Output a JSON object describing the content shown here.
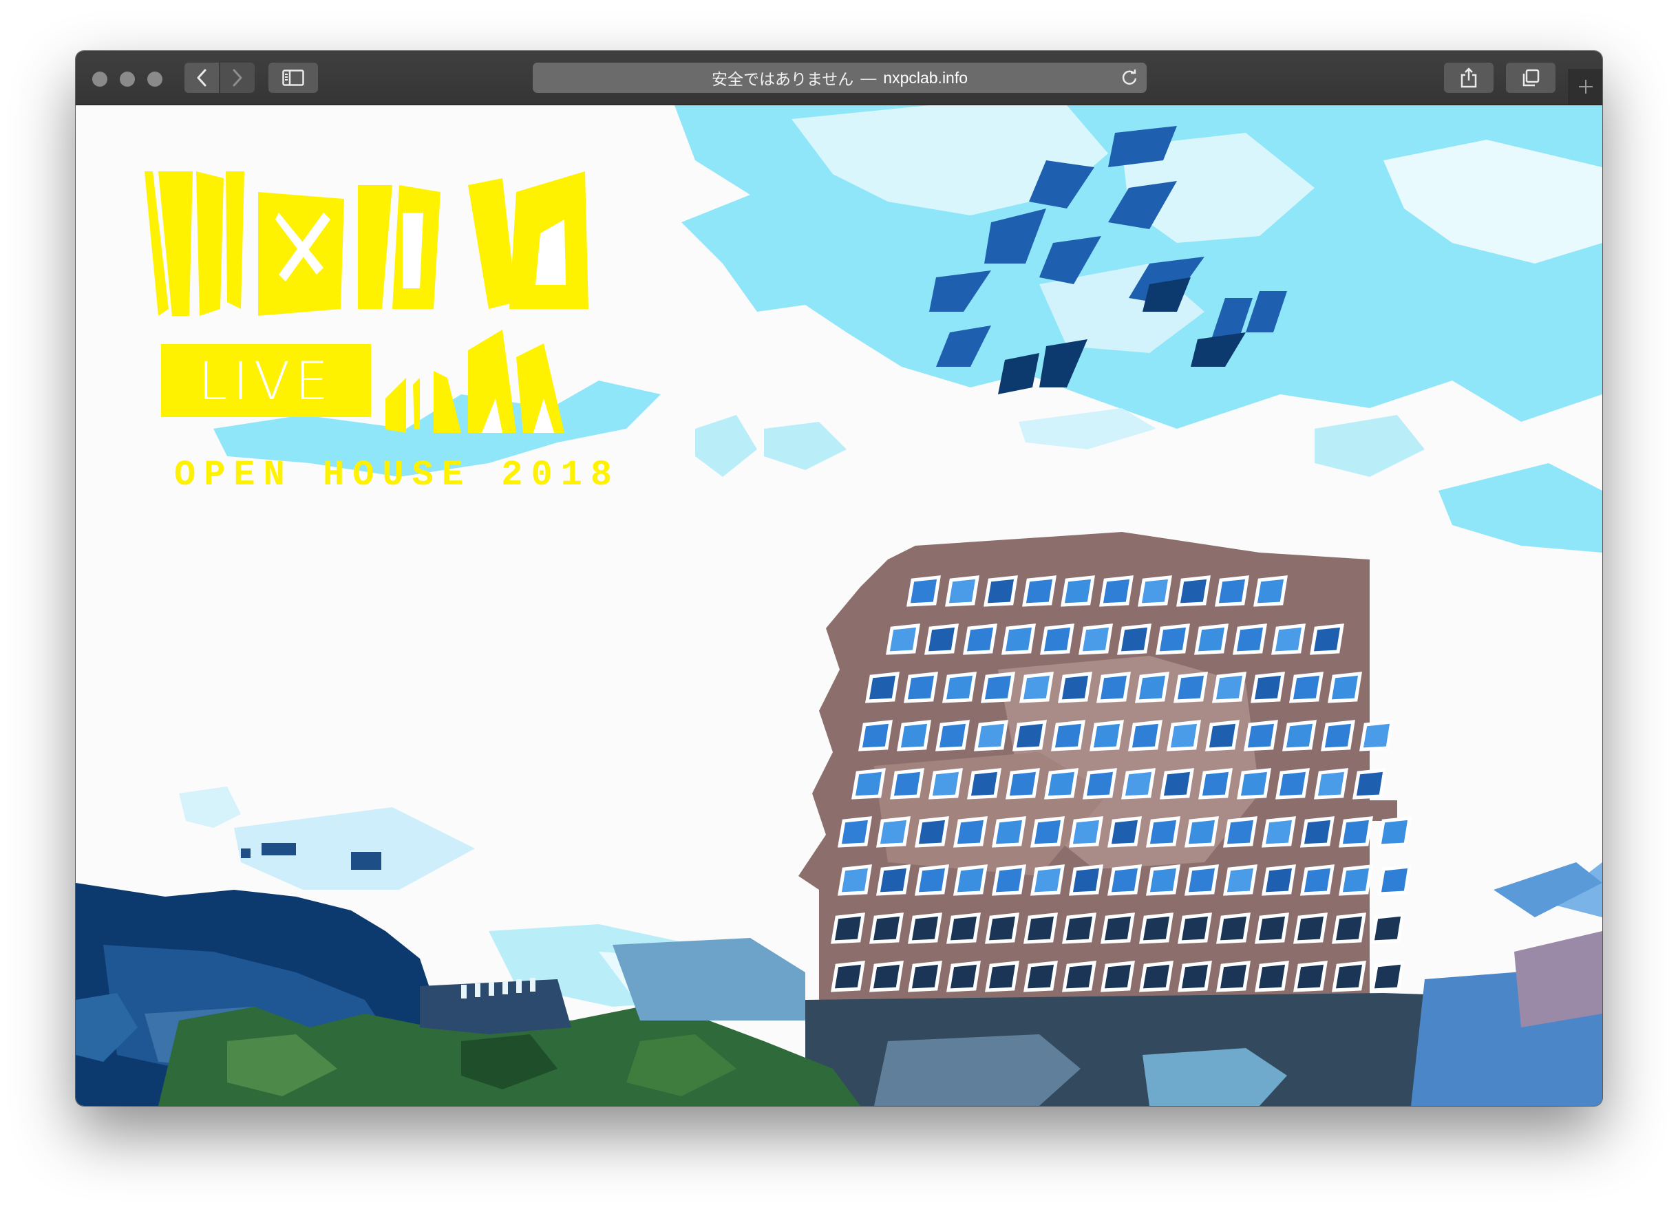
{
  "browser": {
    "address_bar": {
      "security_label": "安全ではありません",
      "separator": "—",
      "host": "nxpclab.info"
    },
    "icons": {
      "back": "chevron-left-icon",
      "forward": "chevron-right-icon",
      "sidebar": "sidebar-icon",
      "reload": "reload-icon",
      "share": "share-icon",
      "tabs": "tabs-icon",
      "new_tab": "plus-icon"
    }
  },
  "hero": {
    "logo_text": "NxPC",
    "live_label": "LIVE",
    "volume": "vol.32",
    "tagline": "OPEN HOUSE 2018",
    "colors": {
      "logo_yellow": "#fff200",
      "sky": "#8fe6f8",
      "building": "#8c6f6c",
      "window_blue": "#2f7fd6",
      "hill": "#0d3a6e",
      "trees": "#2e6a3a"
    }
  }
}
